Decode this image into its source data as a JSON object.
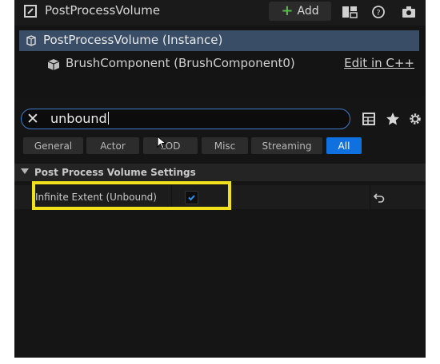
{
  "window": {
    "title": "PostProcessVolume"
  },
  "toolbar": {
    "add_label": "Add"
  },
  "tree": {
    "selected": "PostProcessVolume (Instance)",
    "child": "BrushComponent (BrushComponent0)",
    "edit_link": "Edit in C++"
  },
  "search": {
    "value": "unbound"
  },
  "filters": [
    {
      "label": "General",
      "active": false
    },
    {
      "label": "Actor",
      "active": false
    },
    {
      "label": "LOD",
      "active": false
    },
    {
      "label": "Misc",
      "active": false
    },
    {
      "label": "Streaming",
      "active": false
    },
    {
      "label": "All",
      "active": true
    }
  ],
  "category": {
    "label": "Post Process Volume Settings"
  },
  "property": {
    "label": "Infinite Extent (Unbound)",
    "checked": true
  },
  "colors": {
    "accent": "#0e71df",
    "highlight": "#f0e11a",
    "selected_row": "#3a4d66",
    "add_plus": "#57b84c"
  },
  "icons": [
    "blueprint-icon",
    "add-plus-icon",
    "layout-icon",
    "help-icon",
    "camera-icon",
    "volume-icon",
    "cube-icon",
    "close-icon",
    "table-view-icon",
    "star-icon",
    "gear-icon",
    "mouse-cursor-icon",
    "collapse-triangle-icon",
    "check-icon",
    "reset-arrow-icon"
  ]
}
